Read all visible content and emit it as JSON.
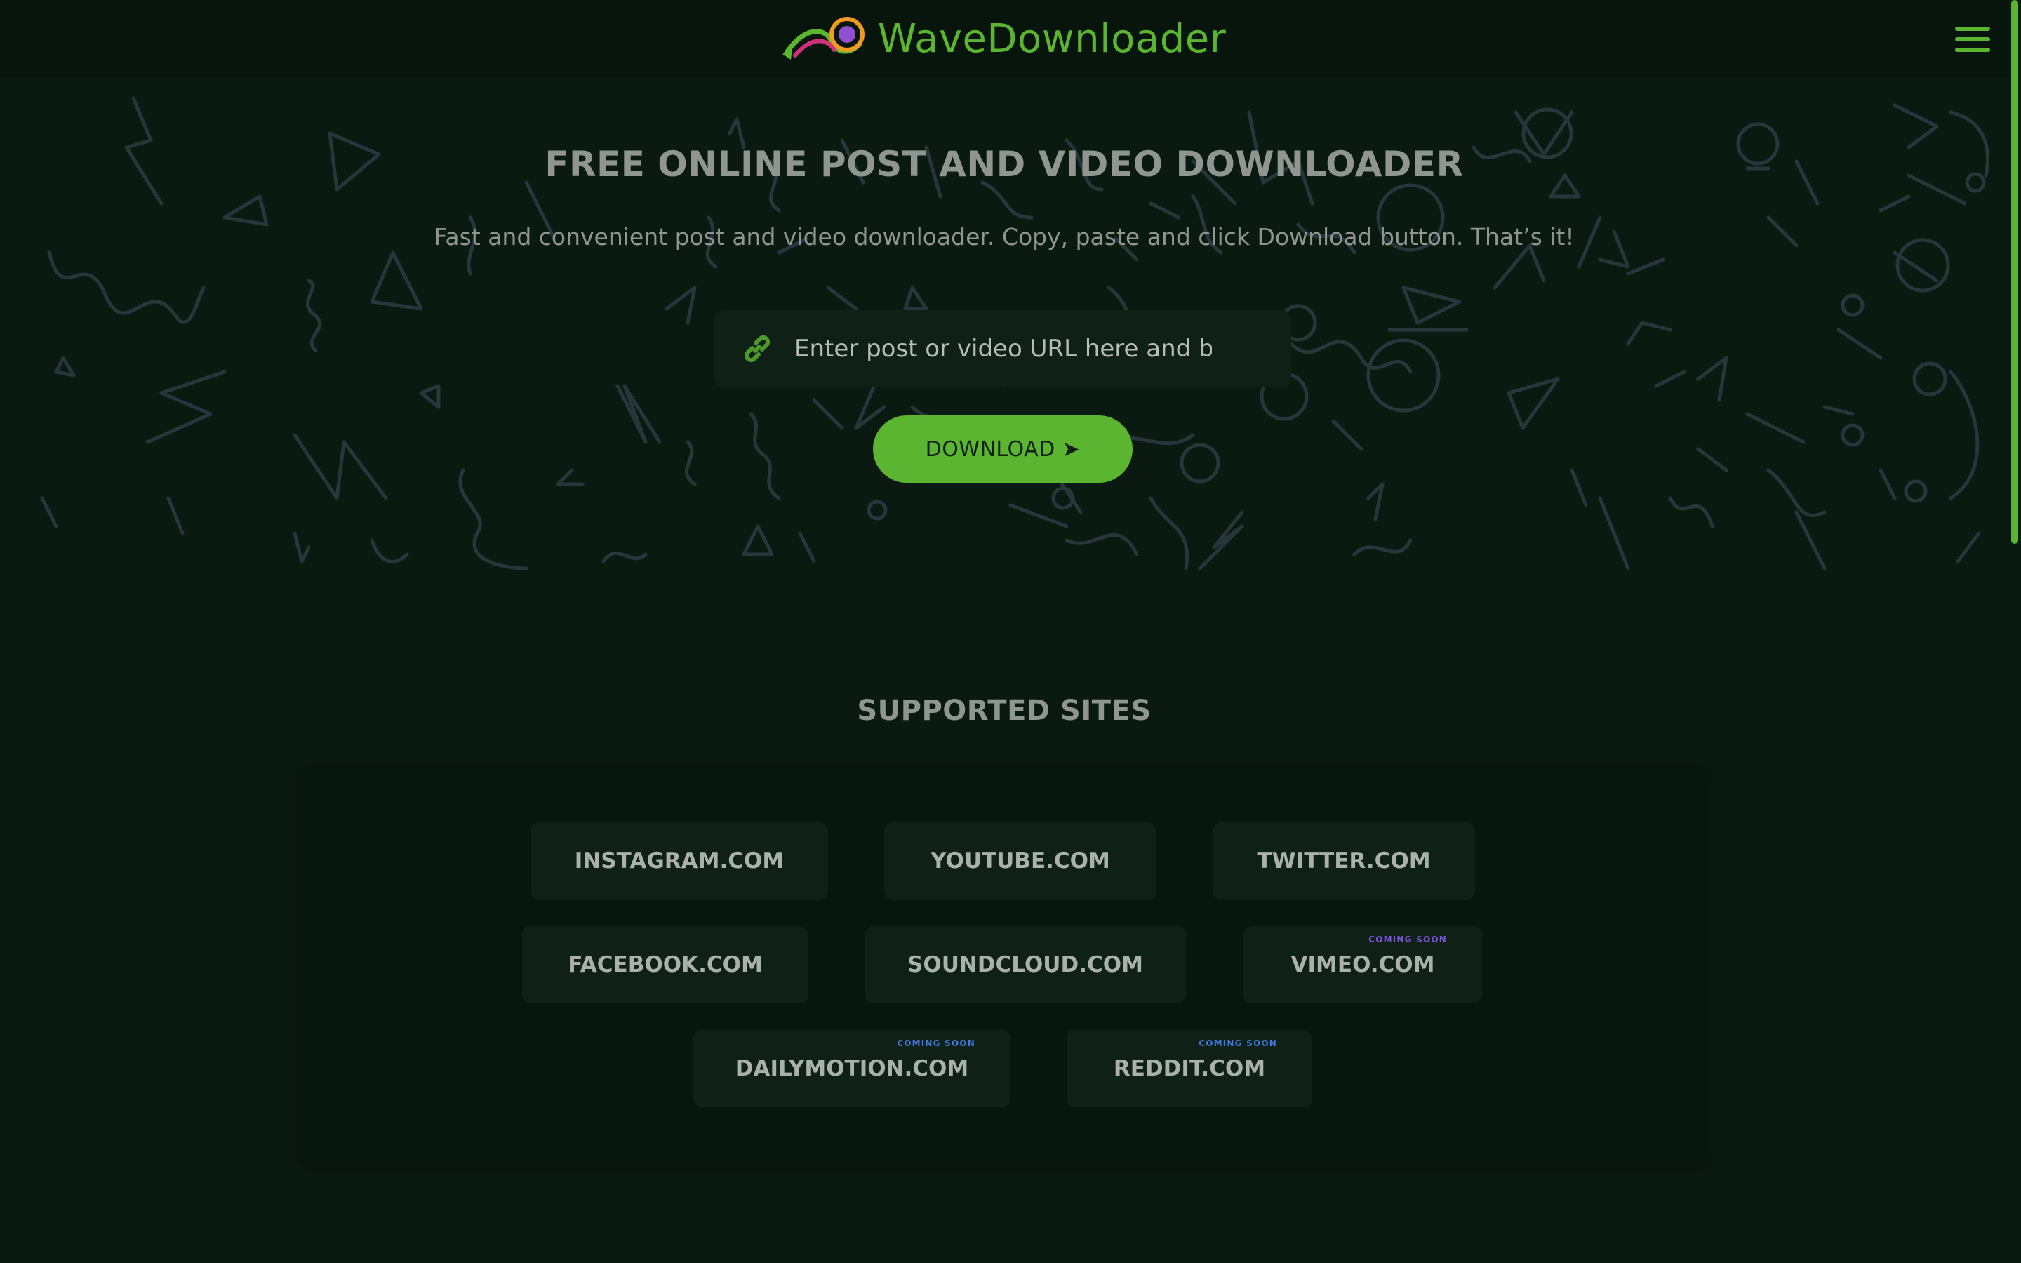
{
  "header": {
    "brand_name": "WaveDownloader",
    "menu_icon": "hamburger-icon"
  },
  "hero": {
    "title": "FREE ONLINE POST AND VIDEO DOWNLOADER",
    "subtitle": "Fast and convenient post and video downloader. Copy, paste and click Download button. That’s it!",
    "url_input": {
      "placeholder": "Enter post or video URL here and begin",
      "value": "",
      "icon": "link-icon"
    },
    "download_button": {
      "label": "DOWNLOAD",
      "icon": "arrow-right-icon",
      "glyph": "➤"
    }
  },
  "supported": {
    "title": "SUPPORTED SITES",
    "sites": [
      {
        "label": "INSTAGRAM.COM",
        "badge": ""
      },
      {
        "label": "YOUTUBE.COM",
        "badge": ""
      },
      {
        "label": "TWITTER.COM",
        "badge": ""
      },
      {
        "label": "FACEBOOK.COM",
        "badge": ""
      },
      {
        "label": "SOUNDCLOUD.COM",
        "badge": ""
      },
      {
        "label": "VIMEO.COM",
        "badge": "COMING SOON"
      },
      {
        "label": "DAILYMOTION.COM",
        "badge": "COMING SOON"
      },
      {
        "label": "REDDIT.COM",
        "badge": "COMING SOON"
      }
    ]
  },
  "colors": {
    "accent": "#5bb531",
    "background": "#0b1a11",
    "badge_purple": "#7a55d8",
    "badge_blue": "#3f78e0"
  }
}
